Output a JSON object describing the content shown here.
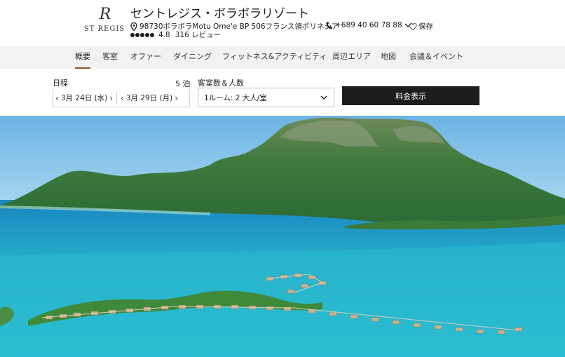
{
  "header": {
    "logo_monogram": "R",
    "logo_brand": "ST REGIS",
    "title": "セントレジス・ボラボラリゾート",
    "address": "98730ボラボラMotu Ome'e BP 506フランス領ポリネシア",
    "phone": "+689 40 60 78 88",
    "save_label": "保存",
    "rating": "4.8",
    "reviews": "316 レビュー",
    "rating_dots": 5
  },
  "nav": {
    "items": [
      {
        "label": "概要",
        "active": true
      },
      {
        "label": "客室"
      },
      {
        "label": "オファー"
      },
      {
        "label": "ダイニング"
      },
      {
        "label": "フィットネス&アクティビティ"
      },
      {
        "label": "周辺エリア"
      },
      {
        "label": "地図"
      },
      {
        "label": "会議＆イベント"
      }
    ]
  },
  "booking": {
    "dates_label": "日程",
    "nights": "5 泊",
    "checkin": "3月 24日 (水)",
    "checkout": "3月 29日 (月)",
    "rooms_label": "客室数＆人数",
    "rooms_value": "1ルーム: 2 大人/室",
    "cta_label": "料金表示"
  },
  "hero": {
    "image": "aerial-lagoon-overwater-villas",
    "colors": {
      "sky": "#7fc0e8",
      "lagoon": "#27b3c9",
      "deep": "#1f8fc0",
      "mountain": "#3e7a3a"
    }
  }
}
